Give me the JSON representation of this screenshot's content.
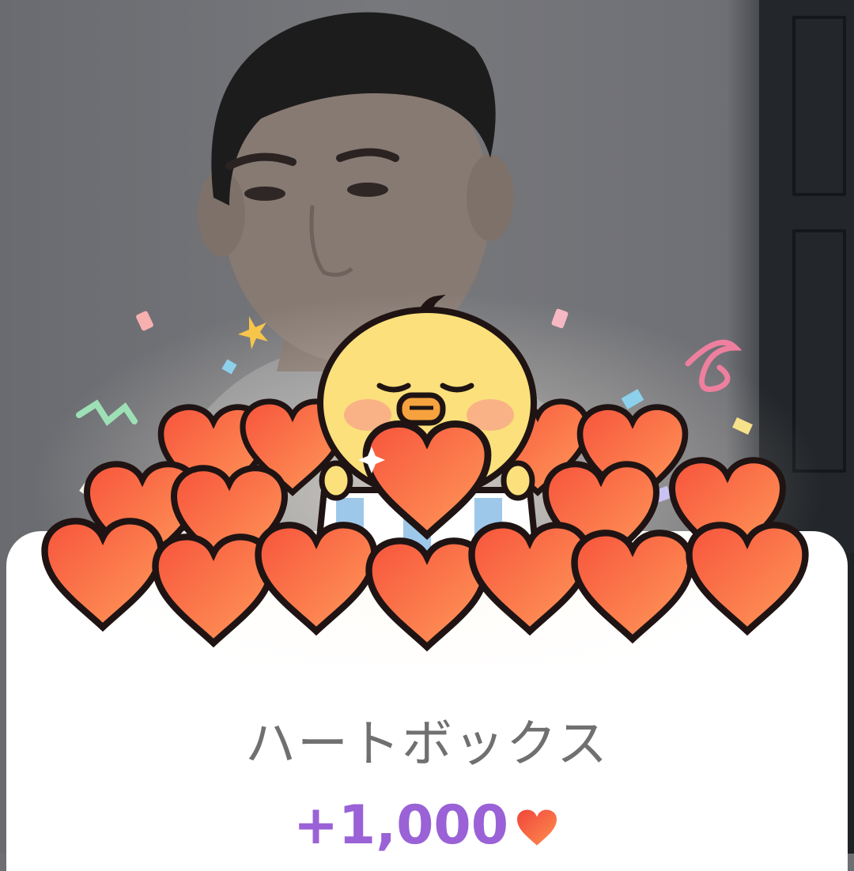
{
  "card": {
    "title": "ハートボックス",
    "reward_amount": "+1,000"
  },
  "icons": {
    "reward": "heart-icon",
    "illustration": "chick-holding-heart-with-hearts"
  },
  "colors": {
    "title_text": "#707070",
    "reward_text": "#9a62d6",
    "heart": "#f0543a",
    "card_bg": "#ffffff"
  }
}
